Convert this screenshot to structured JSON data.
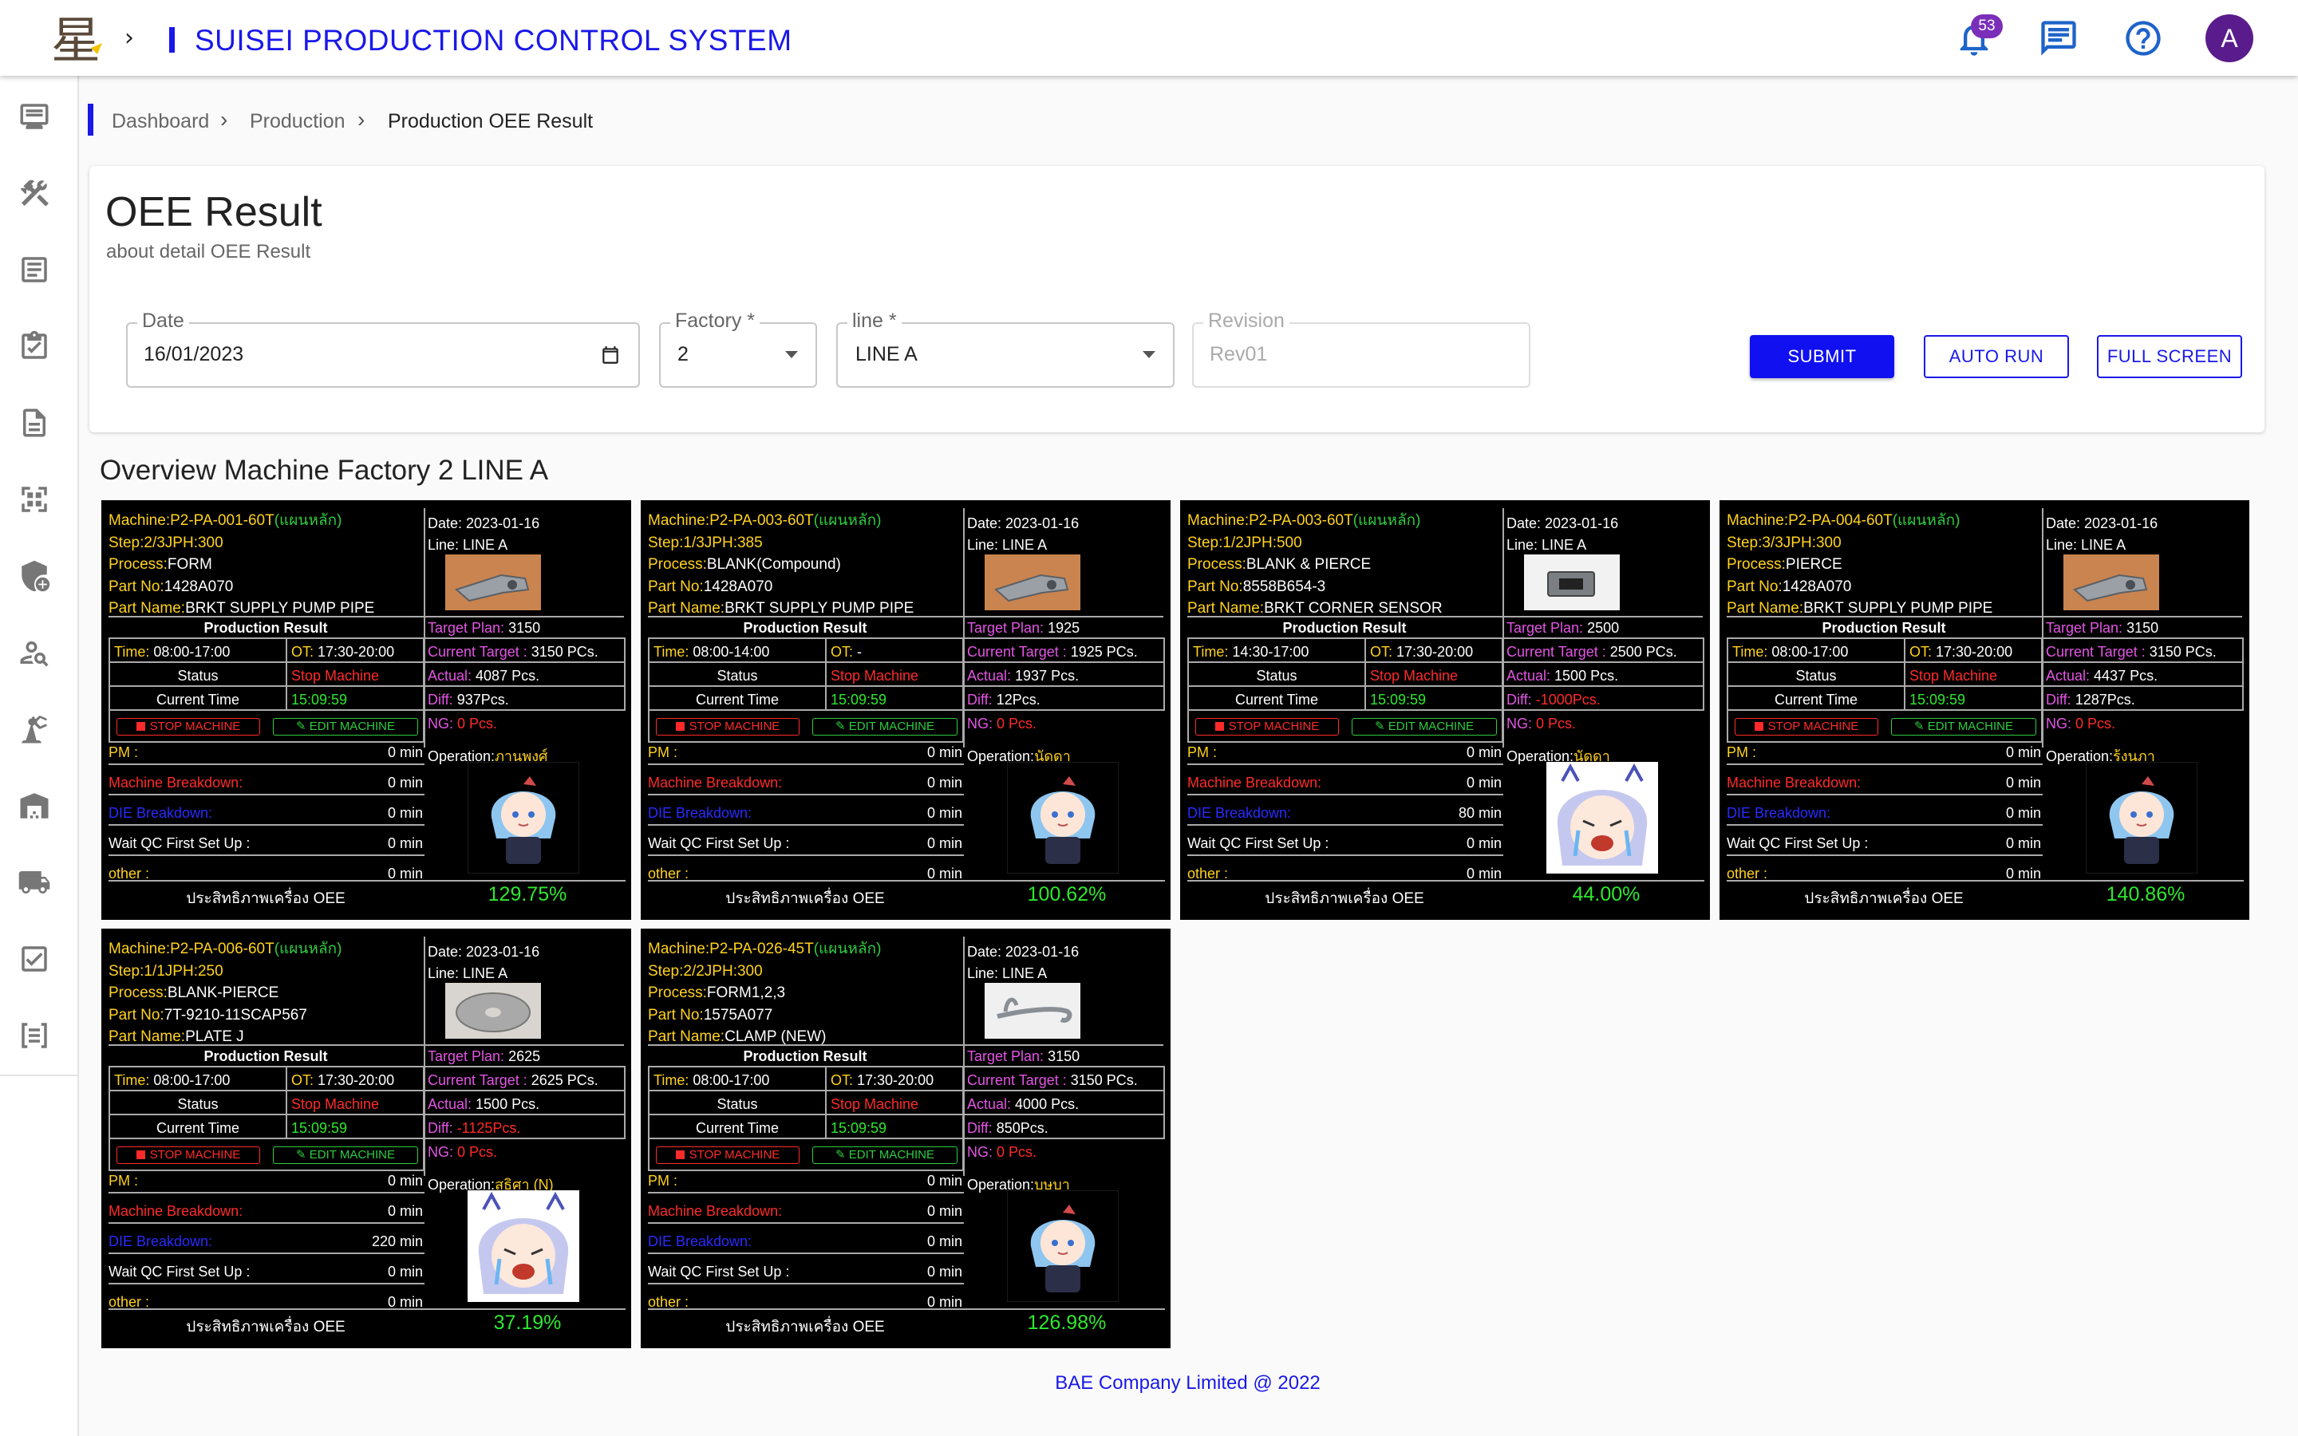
{
  "header": {
    "logo_char": "星",
    "title": "SUISEI PRODUCTION CONTROL SYSTEM",
    "notification_count": "53",
    "avatar_letter": "A"
  },
  "breadcrumb": [
    "Dashboard",
    "Production",
    "Production OEE Result"
  ],
  "page": {
    "title": "OEE Result",
    "subtitle": "about detail OEE Result"
  },
  "filters": {
    "date": {
      "label": "Date",
      "value": "16/01/2023"
    },
    "factory": {
      "label": "Factory *",
      "value": "2"
    },
    "line": {
      "label": "line *",
      "value": "LINE A"
    },
    "revision": {
      "label": "Revision",
      "value": "Rev01"
    }
  },
  "buttons": {
    "submit": "SUBMIT",
    "auto_run": "AUTO RUN",
    "full_screen": "FULL SCREEN"
  },
  "section_title": "Overview Machine Factory 2 LINE A",
  "labels": {
    "machine": "Machine:",
    "machine_note": "(แผนหลัก)",
    "step": "Step:",
    "jph": "JPH:",
    "process": "Process:",
    "part_no": "Part No:",
    "part_name": "Part Name:",
    "date": "Date: ",
    "line": "Line: ",
    "production_result": "Production Result",
    "target_plan": "Target Plan: ",
    "time": "Time: ",
    "ot": "OT: ",
    "current_target": "Current Target : ",
    "status": "Status",
    "actual": "Actual: ",
    "current_time": "Current Time",
    "diff": "Diff: ",
    "stop_machine": "STOP MACHINE",
    "edit_machine": "EDIT MACHINE",
    "ng": "NG: ",
    "pm": "PM :",
    "machine_breakdown": "Machine Breakdown:",
    "die_breakdown": "DIE Breakdown:",
    "wait_qc": "Wait QC First Set Up :",
    "other": "other :",
    "operation": "Operation:",
    "oee_label": "ประสิทธิภาพเครื่อง OEE"
  },
  "machines": [
    {
      "machine": "P2-PA-001-60T",
      "step": "2/3",
      "jph": "300",
      "process": "FORM",
      "part_no": "1428A070",
      "part_name": "BRKT SUPPLY PUMP PIPE",
      "date": "2023-01-16",
      "line": "LINE A",
      "target_plan": "3150",
      "time": "08:00-17:00",
      "ot": "17:30-20:00",
      "current_target": "3150 PCs.",
      "status": "Stop Machine",
      "actual": "4087 Pcs.",
      "current_time": "15:09:59",
      "diff": "937Pcs.",
      "diff_negative": false,
      "ng": "0 Pcs.",
      "pm": "0 min",
      "machine_breakdown": "0 min",
      "die_breakdown": "0 min",
      "wait_qc": "0 min",
      "other": "0 min",
      "operator": "ภานุพงศ์",
      "oee": "129.75%",
      "part_img": "bracket",
      "avatar": "chibi"
    },
    {
      "machine": "P2-PA-003-60T",
      "step": "1/3",
      "jph": "385",
      "process": "BLANK(Compound)",
      "part_no": "1428A070",
      "part_name": "BRKT SUPPLY PUMP PIPE",
      "date": "2023-01-16",
      "line": "LINE A",
      "target_plan": "1925",
      "time": "08:00-14:00",
      "ot": "-",
      "current_target": "1925 PCs.",
      "status": "Stop Machine",
      "actual": "1937 Pcs.",
      "current_time": "15:09:59",
      "diff": "12Pcs.",
      "diff_negative": false,
      "ng": "0 Pcs.",
      "pm": "0 min",
      "machine_breakdown": "0 min",
      "die_breakdown": "0 min",
      "wait_qc": "0 min",
      "other": "0 min",
      "operator": "นัดดา",
      "oee": "100.62%",
      "part_img": "bracket",
      "avatar": "chibi"
    },
    {
      "machine": "P2-PA-003-60T",
      "step": "1/2",
      "jph": "500",
      "process": "BLANK & PIERCE",
      "part_no": "8558B654-3",
      "part_name": "BRKT CORNER SENSOR",
      "date": "2023-01-16",
      "line": "LINE A",
      "target_plan": "2500",
      "time": "14:30-17:00",
      "ot": "17:30-20:00",
      "current_target": "2500 PCs.",
      "status": "Stop Machine",
      "actual": "1500 Pcs.",
      "current_time": "15:09:59",
      "diff": "-1000Pcs.",
      "diff_negative": true,
      "ng": "0 Pcs.",
      "pm": "0 min",
      "machine_breakdown": "0 min",
      "die_breakdown": "80 min",
      "wait_qc": "0 min",
      "other": "0 min",
      "operator": "นัดดา",
      "oee": "44.00%",
      "part_img": "sensor",
      "avatar": "cry"
    },
    {
      "machine": "P2-PA-004-60T",
      "step": "3/3",
      "jph": "300",
      "process": "PIERCE",
      "part_no": "1428A070",
      "part_name": "BRKT SUPPLY PUMP PIPE",
      "date": "2023-01-16",
      "line": "LINE A",
      "target_plan": "3150",
      "time": "08:00-17:00",
      "ot": "17:30-20:00",
      "current_target": "3150 PCs.",
      "status": "Stop Machine",
      "actual": "4437 Pcs.",
      "current_time": "15:09:59",
      "diff": "1287Pcs.",
      "diff_negative": false,
      "ng": "0 Pcs.",
      "pm": "0 min",
      "machine_breakdown": "0 min",
      "die_breakdown": "0 min",
      "wait_qc": "0 min",
      "other": "0 min",
      "operator": "รุ้งนภา",
      "oee": "140.86%",
      "part_img": "bracket",
      "avatar": "chibi"
    },
    {
      "machine": "P2-PA-006-60T",
      "step": "1/1",
      "jph": "250",
      "process": "BLANK-PIERCE",
      "part_no": "7T-9210-11SCAP567",
      "part_name": "PLATE J",
      "date": "2023-01-16",
      "line": "LINE A",
      "target_plan": "2625",
      "time": "08:00-17:00",
      "ot": "17:30-20:00",
      "current_target": "2625 PCs.",
      "status": "Stop Machine",
      "actual": "1500 Pcs.",
      "current_time": "15:09:59",
      "diff": "-1125Pcs.",
      "diff_negative": true,
      "ng": "0 Pcs.",
      "pm": "0 min",
      "machine_breakdown": "0 min",
      "die_breakdown": "220 min",
      "wait_qc": "0 min",
      "other": "0 min",
      "operator": "สุธิศา (N)",
      "oee": "37.19%",
      "part_img": "plate",
      "avatar": "cry"
    },
    {
      "machine": "P2-PA-026-45T",
      "step": "2/2",
      "jph": "300",
      "process": "FORM1,2,3",
      "part_no": "1575A077",
      "part_name": "CLAMP (NEW)",
      "date": "2023-01-16",
      "line": "LINE A",
      "target_plan": "3150",
      "time": "08:00-17:00",
      "ot": "17:30-20:00",
      "current_target": "3150 PCs.",
      "status": "Stop Machine",
      "actual": "4000 Pcs.",
      "current_time": "15:09:59",
      "diff": "850Pcs.",
      "diff_negative": false,
      "ng": "0 Pcs.",
      "pm": "0 min",
      "machine_breakdown": "0 min",
      "die_breakdown": "0 min",
      "wait_qc": "0 min",
      "other": "0 min",
      "operator": "บุษบา",
      "oee": "126.98%",
      "part_img": "clamp",
      "avatar": "chibi"
    }
  ],
  "footer": "BAE Company Limited @ 2022"
}
